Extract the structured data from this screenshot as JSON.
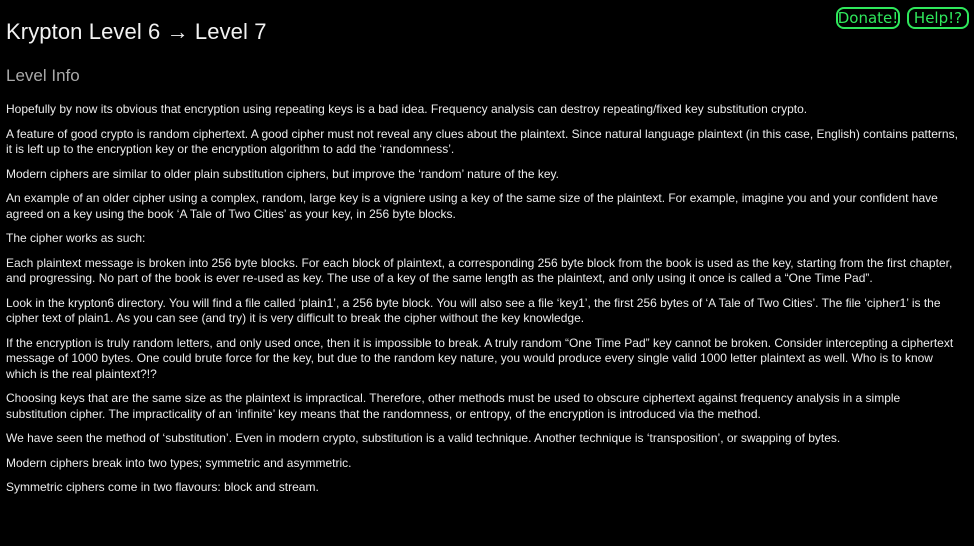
{
  "header": {
    "title": "Krypton Level 6 → Level 7",
    "subtitle": "Level Info",
    "buttons": {
      "donate": "Donate!",
      "help": "Help!?"
    },
    "accent_color": "#2fe85c"
  },
  "content": {
    "paragraphs": [
      "Hopefully by now its obvious that encryption using repeating keys is a bad idea. Frequency analysis can destroy repeating/fixed key substitution crypto.",
      "A feature of good crypto is random ciphertext. A good cipher must not reveal any clues about the plaintext. Since natural language plaintext (in this case, English) contains patterns, it is left up to the encryption key or the encryption algorithm to add the ‘randomness’.",
      "Modern ciphers are similar to older plain substitution ciphers, but improve the ‘random’ nature of the key.",
      "An example of an older cipher using a complex, random, large key is a vigniere using a key of the same size of the plaintext. For example, imagine you and your confident have agreed on a key using the book ‘A Tale of Two Cities’ as your key, in 256 byte blocks.",
      "The cipher works as such:",
      "Each plaintext message is broken into 256 byte blocks. For each block of plaintext, a corresponding 256 byte block from the book is used as the key, starting from the first chapter, and progressing. No part of the book is ever re-used as key. The use of a key of the same length as the plaintext, and only using it once is called a “One Time Pad”.",
      "Look in the krypton6 directory. You will find a file called ‘plain1’, a 256 byte block. You will also see a file ‘key1’, the first 256 bytes of ‘A Tale of Two Cities’. The file ‘cipher1’ is the cipher text of plain1. As you can see (and try) it is very difficult to break the cipher without the key knowledge.",
      "If the encryption is truly random letters, and only used once, then it is impossible to break. A truly random “One Time Pad” key cannot be broken. Consider intercepting a ciphertext message of 1000 bytes. One could brute force for the key, but due to the random key nature, you would produce every single valid 1000 letter plaintext as well. Who is to know which is the real plaintext?!?",
      "Choosing keys that are the same size as the plaintext is impractical. Therefore, other methods must be used to obscure ciphertext against frequency analysis in a simple substitution cipher. The impracticality of an ‘infinite’ key means that the randomness, or entropy, of the encryption is introduced via the method.",
      "We have seen the method of ‘substitution’. Even in modern crypto, substitution is a valid technique. Another technique is ‘transposition’, or swapping of bytes.",
      "Modern ciphers break into two types; symmetric and asymmetric.",
      "Symmetric ciphers come in two flavours: block and stream."
    ]
  }
}
